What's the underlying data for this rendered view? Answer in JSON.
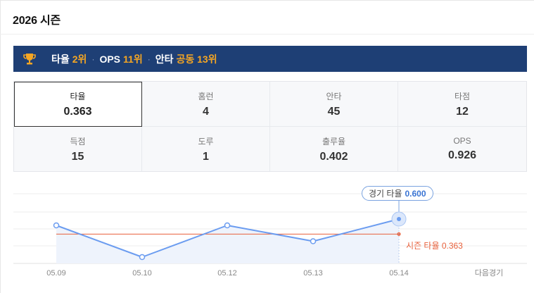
{
  "header": {
    "title": "2026 시즌"
  },
  "rank_bar": {
    "icon": "trophy-icon",
    "items": [
      {
        "label": "타율",
        "value": "2위"
      },
      {
        "label": "OPS",
        "value": "11위"
      },
      {
        "label": "안타",
        "value": "공동 13위"
      }
    ],
    "separator": "·"
  },
  "stats": [
    {
      "label": "타율",
      "value": "0.363",
      "active": true
    },
    {
      "label": "홈런",
      "value": "4"
    },
    {
      "label": "안타",
      "value": "45"
    },
    {
      "label": "타점",
      "value": "12"
    },
    {
      "label": "득점",
      "value": "15"
    },
    {
      "label": "도루",
      "value": "1"
    },
    {
      "label": "출루율",
      "value": "0.402"
    },
    {
      "label": "OPS",
      "value": "0.926"
    }
  ],
  "chart": {
    "tooltip": {
      "label": "경기 타율",
      "value": "0.600"
    },
    "average_label": "시즌 타율 0.363",
    "next_game_label": "다음경기",
    "colors": {
      "line": "#6b9cf0",
      "average": "#e8613c",
      "area": "#eef3fc"
    }
  },
  "chart_data": {
    "type": "line",
    "categories": [
      "05.09",
      "05.10",
      "05.12",
      "05.13",
      "05.14"
    ],
    "values": [
      0.5,
      0.0,
      0.5,
      0.25,
      0.6
    ],
    "average": 0.363,
    "ylim": [
      -0.1,
      1.0
    ],
    "grid": true,
    "highlight_index": 4
  }
}
